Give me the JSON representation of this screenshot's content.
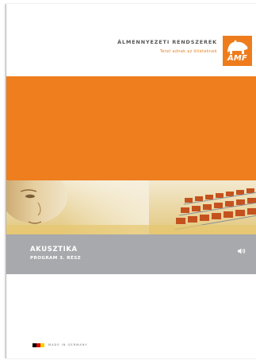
{
  "header": {
    "title": "ÁLMENNYEZETI RENDSZEREK",
    "subtitle": "Teret adnak az ötleteknek"
  },
  "logo": {
    "text": "AMF",
    "icon": "amf-logo-icon",
    "color": "#ee7c1c"
  },
  "colors": {
    "orange_band": "#ef7e1e",
    "grey_band": "#a7a9ac"
  },
  "section": {
    "title": "AKUSZTIKA",
    "subtitle": "PROGRAM 3. RÉSZ",
    "icon": "speaker-icon"
  },
  "footer": {
    "flag_icon": "german-flag-icon",
    "flag_colors": [
      "#000000",
      "#dd0000",
      "#ffce00"
    ],
    "text": "MADE IN GERMANY"
  }
}
